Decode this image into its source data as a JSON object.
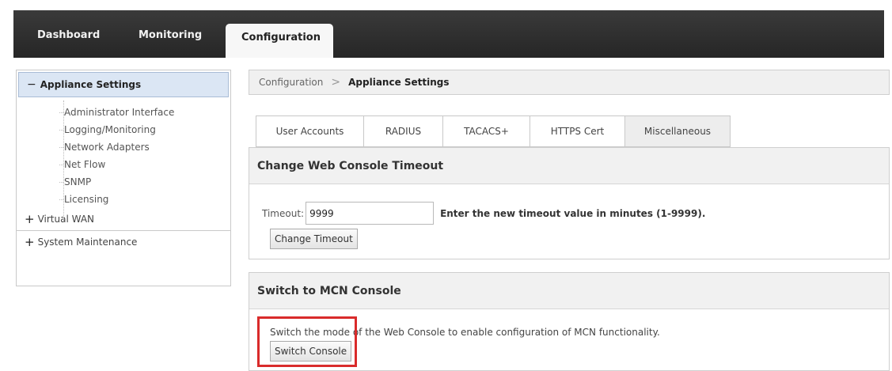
{
  "topnav": {
    "items": [
      {
        "label": "Dashboard"
      },
      {
        "label": "Monitoring"
      },
      {
        "label": "Configuration"
      }
    ]
  },
  "sidebar": {
    "section_title": "Appliance Settings",
    "section_sign": "−",
    "items": [
      {
        "label": "Administrator Interface"
      },
      {
        "label": "Logging/Monitoring"
      },
      {
        "label": "Network Adapters"
      },
      {
        "label": "Net Flow"
      },
      {
        "label": "SNMP"
      },
      {
        "label": "Licensing"
      }
    ],
    "groups": [
      {
        "sign": "+",
        "label": "Virtual WAN"
      },
      {
        "sign": "+",
        "label": "System Maintenance"
      }
    ]
  },
  "breadcrumb": {
    "root": "Configuration",
    "separator": ">",
    "current": "Appliance Settings"
  },
  "tabs": [
    {
      "label": "User Accounts"
    },
    {
      "label": "RADIUS"
    },
    {
      "label": "TACACS+"
    },
    {
      "label": "HTTPS Cert"
    },
    {
      "label": "Miscellaneous",
      "active": true
    }
  ],
  "timeout_panel": {
    "title": "Change Web Console Timeout",
    "label": "Timeout:",
    "value": "9999",
    "hint": "Enter the new timeout value in minutes (1-9999).",
    "button": "Change Timeout"
  },
  "mcn_panel": {
    "title": "Switch to MCN Console",
    "description": "Switch the mode of the Web Console to enable configuration of MCN functionality.",
    "button": "Switch Console"
  },
  "colors": {
    "topbar": "#2e2e2e",
    "sidebar_header": "#dbe6f4",
    "highlight": "#d92b2b"
  }
}
